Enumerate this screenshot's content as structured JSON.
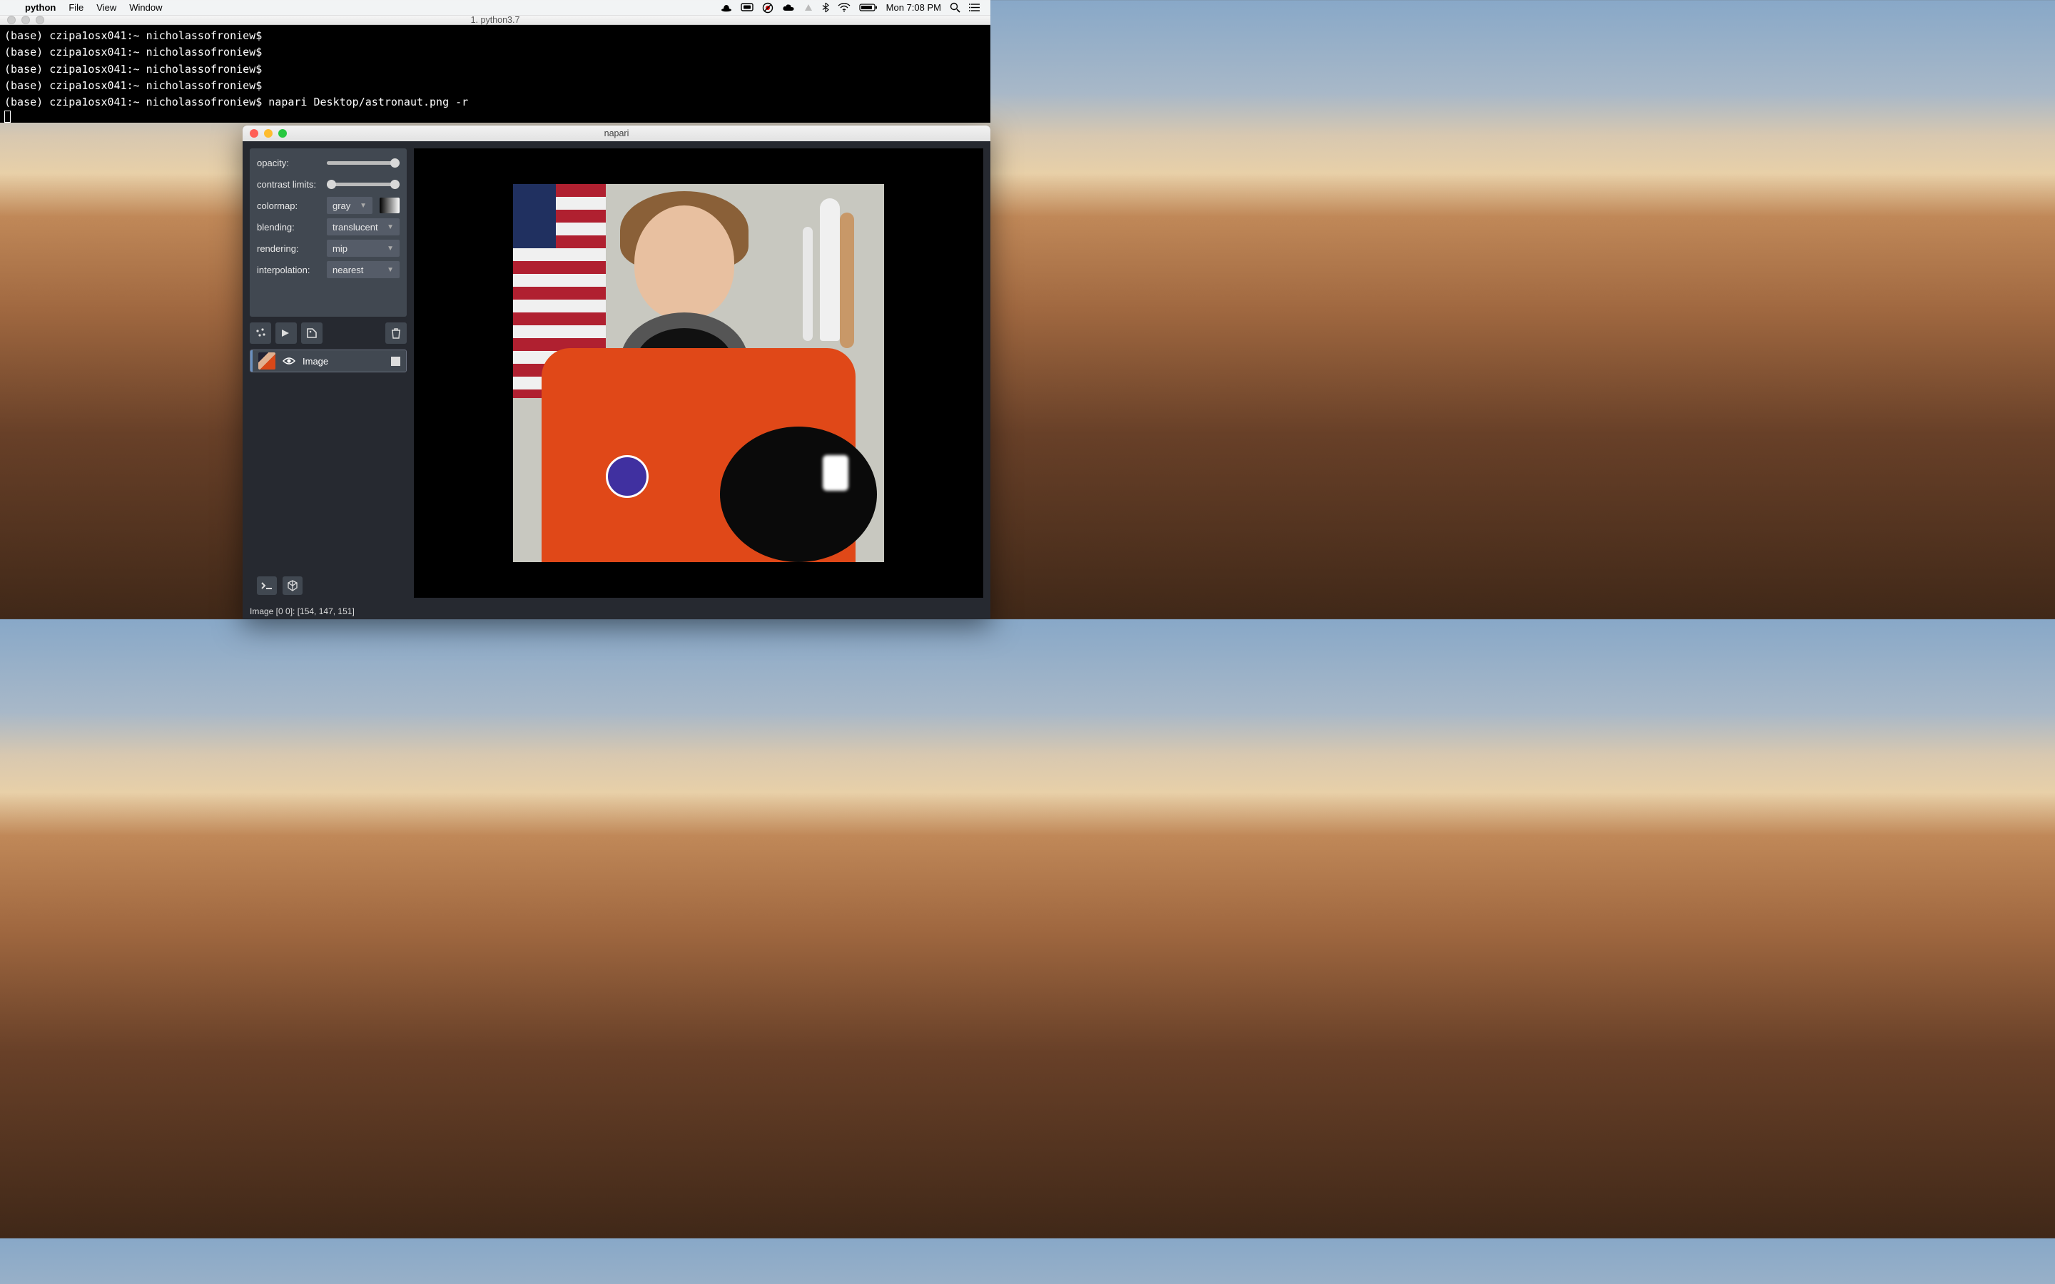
{
  "menubar": {
    "app": "python",
    "items": [
      "File",
      "View",
      "Window"
    ],
    "clock": "Mon 7:08 PM"
  },
  "terminal": {
    "title": "1. python3.7",
    "prompt": "(base) czipa1osx041:~ nicholassofroniew$",
    "lines": [
      "(base) czipa1osx041:~ nicholassofroniew$",
      "(base) czipa1osx041:~ nicholassofroniew$",
      "(base) czipa1osx041:~ nicholassofroniew$",
      "(base) czipa1osx041:~ nicholassofroniew$",
      "(base) czipa1osx041:~ nicholassofroniew$ napari Desktop/astronaut.png -r"
    ]
  },
  "napari": {
    "title": "napari",
    "controls": {
      "opacity_label": "opacity:",
      "contrast_label": "contrast limits:",
      "colormap_label": "colormap:",
      "colormap_value": "gray",
      "blending_label": "blending:",
      "blending_value": "translucent",
      "rendering_label": "rendering:",
      "rendering_value": "mip",
      "interpolation_label": "interpolation:",
      "interpolation_value": "nearest"
    },
    "layer": {
      "name": "Image"
    },
    "status": "Image [0 0]: [154, 147, 151]"
  }
}
